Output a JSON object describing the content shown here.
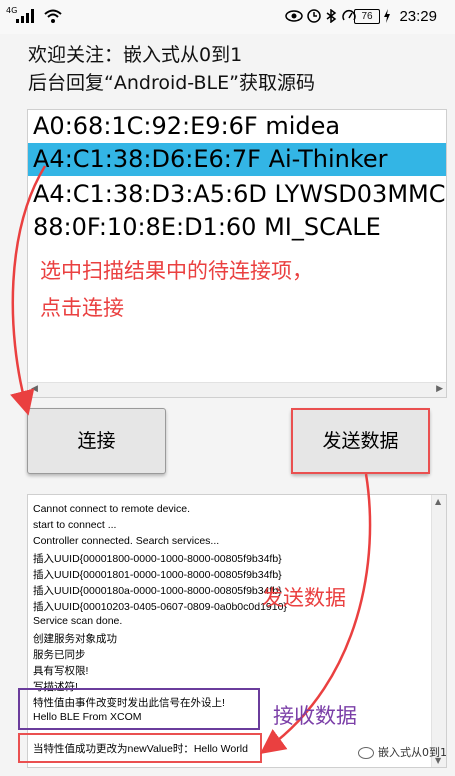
{
  "status_bar": {
    "signal_label": "4G",
    "battery": "76",
    "time": "23:29"
  },
  "header": {
    "line1": "欢迎关注：嵌入式从0到1",
    "line2": "后台回复“Android-BLE”获取源码"
  },
  "device_list": {
    "items": [
      {
        "text": "A0:68:1C:92:E9:6F midea",
        "selected": false
      },
      {
        "text": "A4:C1:38:D6:E6:7F Ai-Thinker",
        "selected": true
      },
      {
        "text": "A4:C1:38:D3:A5:6D LYWSD03MMC",
        "selected": false
      },
      {
        "text": "88:0F:10:8E:D1:60 MI_SCALE",
        "selected": false
      }
    ],
    "selected_color": "#33b5e5"
  },
  "buttons": {
    "connect": "连接",
    "send": "发送数据"
  },
  "log": {
    "lines": [
      "Cannot connect to remote device.",
      "start to connect ...",
      "Controller connected. Search services...",
      "插入UUID{00001800-0000-1000-8000-00805f9b34fb}",
      "插入UUID{00001801-0000-1000-8000-00805f9b34fb}",
      "插入UUID{0000180a-0000-1000-8000-00805f9b34fb}",
      "插入UUID{00010203-0405-0607-0809-0a0b0c0d1910}",
      "Service scan done.",
      "创建服务对象成功",
      "服务已同步",
      "具有写权限!",
      "写描述符!",
      "特性值由事件改变时发出此信号在外设上!",
      "Hello BLE From XCOM",
      "",
      "当特性值成功更改为newValue时：Hello World"
    ]
  },
  "annotations": {
    "select_hint_1": "选中扫描结果中的待连接项，",
    "select_hint_2": "点击连接",
    "send_data": "发送数据",
    "receive_data": "接收数据",
    "red": "#ea4040",
    "purple": "#6a3c9c"
  },
  "watermark": "嵌入式从0到1"
}
